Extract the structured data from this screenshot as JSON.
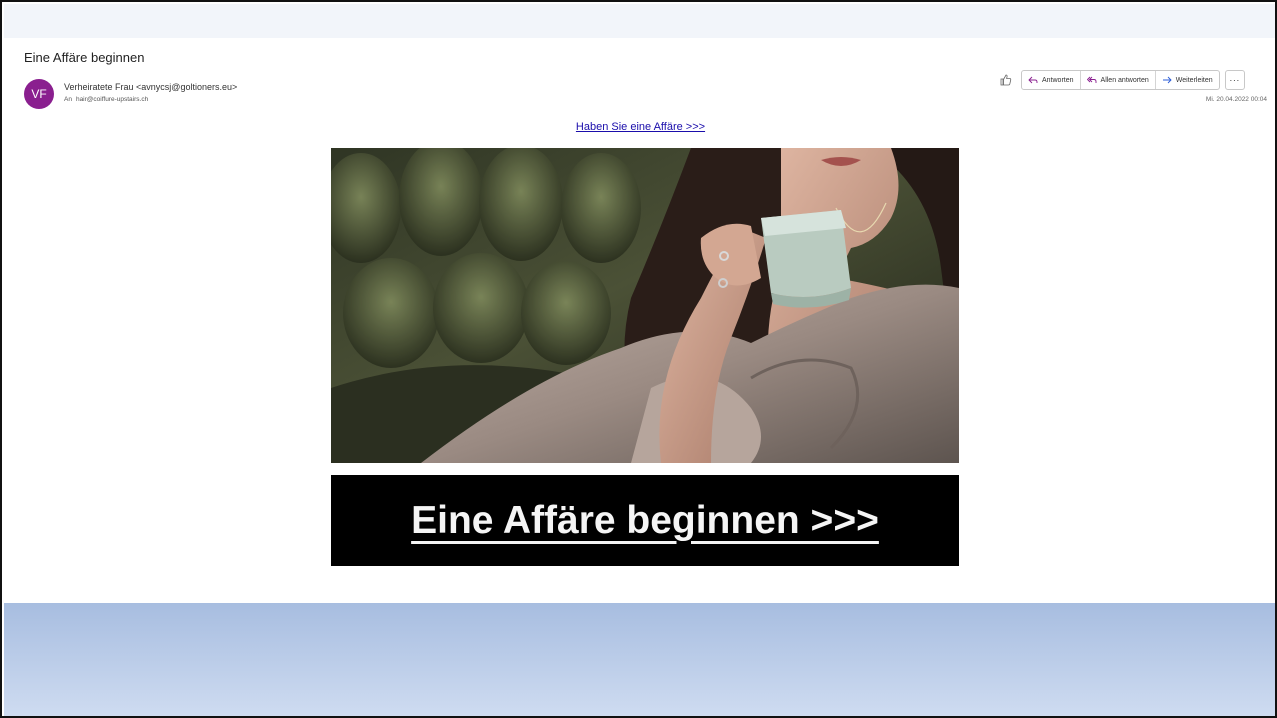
{
  "email": {
    "subject": "Eine Affäre beginnen",
    "avatar_initials": "VF",
    "avatar_color": "#8a1f8f",
    "sender": "Verheiratete Frau <avnycsj@goltioners.eu>",
    "recipient_label": "An",
    "recipient": "hair@coiffure-upstairs.ch",
    "timestamp": "Mi. 20.04.2022 00:04"
  },
  "toolbar": {
    "like_icon": "thumbs-up-icon",
    "reply_label": "Antworten",
    "reply_all_label": "Allen antworten",
    "forward_label": "Weiterleiten",
    "more_label": "···"
  },
  "body": {
    "top_link": "Haben Sie eine Affäre >>>",
    "image_icon": "woman-with-coffee-cup-photo",
    "banner_link": "Eine Affäre beginnen >>>",
    "banner_bg": "#000000",
    "link_color": "#1a0dab"
  }
}
